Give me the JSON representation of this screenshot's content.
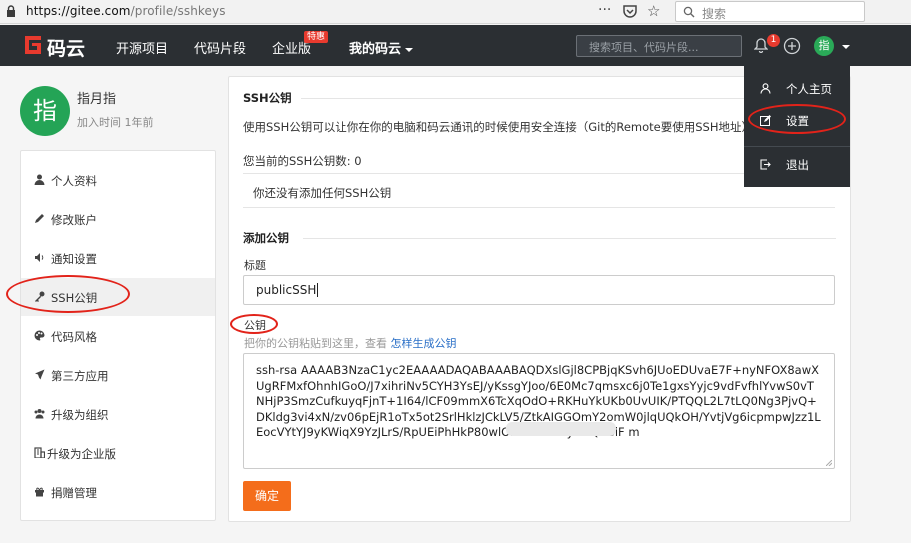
{
  "browser": {
    "url_host": "https://gitee.com",
    "url_path": "/profile/sshkeys",
    "search_placeholder": "搜索",
    "dots": "···",
    "star": "☆"
  },
  "nav": {
    "logo_text": "码云",
    "links": [
      "开源项目",
      "代码片段",
      "企业版",
      "我的码云"
    ],
    "enterprise_badge": "特惠",
    "search_placeholder": "搜索项目、代码片段...",
    "notification_count": "1",
    "avatar_text": "指"
  },
  "profile": {
    "avatar_text": "指",
    "name": "指月指",
    "joined": "加入时间 1年前"
  },
  "sidebar": {
    "items": [
      {
        "label": "个人资料",
        "icon": "user-icon"
      },
      {
        "label": "修改账户",
        "icon": "pencil-icon"
      },
      {
        "label": "通知设置",
        "icon": "volume-icon"
      },
      {
        "label": "SSH公钥",
        "icon": "key-icon"
      },
      {
        "label": "代码风格",
        "icon": "palette-icon"
      },
      {
        "label": "第三方应用",
        "icon": "rocket-icon"
      },
      {
        "label": "升级为组织",
        "icon": "group-icon"
      },
      {
        "label": "升级为企业版",
        "icon": "building-icon"
      },
      {
        "label": "捐赠管理",
        "icon": "gift-icon"
      }
    ],
    "active_index": 3
  },
  "main": {
    "ssh_title": "SSH公钥",
    "description": "使用SSH公钥可以让你在你的电脑和码云通讯的时候使用安全连接（Git的Remote要使用SSH地址）",
    "count_text": "您当前的SSH公钥数: 0",
    "no_key_text": "你还没有添加任何SSH公钥",
    "add_title": "添加公钥",
    "title_label": "标题",
    "title_value": "publicSSH",
    "key_label": "公钥",
    "key_hint": "把你的公钥粘贴到这里，查看",
    "key_hint_link": "怎样生成公钥",
    "key_value": "ssh-rsa AAAAB3NzaC1yc2EAAAADAQABAAABAQDXslGjl8CPBjqKSvh6JUoEDUvaE7F+nyNFOX8awXUgRFMxfOhnhIGoO/J7xihriNv5CYH3YsEJ/yKssgYJoo/6E0Mc7qmsxc6j0Te1gxsYyjc9vdFvfhlYvwS0vTNHjP3SmzCufkuyqFjnT+1I64/lCF09mmX6TcXqOdO+RKHuYkUKb0UvUIK/PTQQL2L7tLQ0Ng3PjvQ+DKldg3vi4xN/zv06pEjR1oTx5ot2SrlHklzJCkLV5/ZtkAIGGOmY2omW0jlqUQkOH/YvtjVg6icpmpwJzz1LEocVYtYJ9yKWiqX9YzJLrS/RpUEiPhHkP80wlOfwC26FTflys2iQUSiF                       m",
    "submit_label": "确定"
  },
  "dropdown": {
    "items": [
      {
        "label": "个人主页",
        "icon": "person-icon"
      },
      {
        "label": "设置",
        "icon": "edit-icon"
      },
      {
        "label": "退出",
        "icon": "logout-icon"
      }
    ]
  },
  "colors": {
    "nav_bg": "#2b2f33",
    "brand_red": "#e83a2e",
    "avatar_green": "#24a456",
    "button_orange": "#f46d1b",
    "link_blue": "#2a6fc7",
    "annotation_red": "#e2231a"
  }
}
